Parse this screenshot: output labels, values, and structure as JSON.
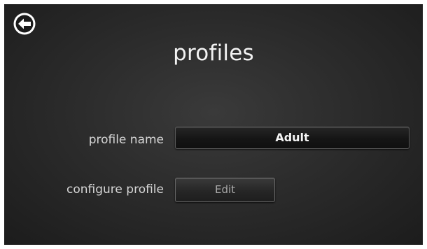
{
  "header": {
    "title": "profiles",
    "back_icon": "arrow-left-circle-icon"
  },
  "form": {
    "profile_name_label": "profile name",
    "profile_name_value": "Adult",
    "configure_label": "configure profile",
    "edit_label": "Edit"
  },
  "colors": {
    "background": "#2c2c2c",
    "text": "#ececec",
    "button_border": "#5a5a5a"
  }
}
